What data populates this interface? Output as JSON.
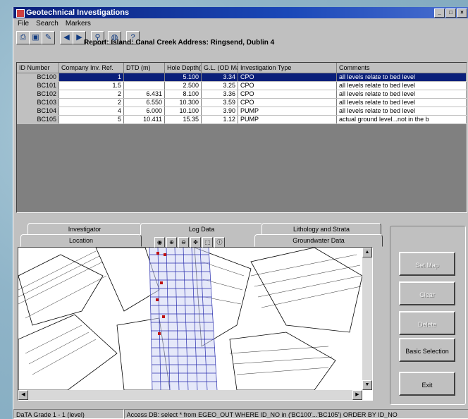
{
  "window": {
    "title": "Geotechnical Investigations"
  },
  "menu": [
    "File",
    "Search",
    "Markers"
  ],
  "report_line": "Report: Island: Canal Creek  Address: Ringsend, Dublin 4",
  "grid": {
    "headers": [
      "ID Number",
      "Company Inv. Ref.",
      "DTD (m)",
      "Hole Depth(m)",
      "G.L. (OD Malin)",
      "Investigation Type",
      "Comments"
    ],
    "rows": [
      [
        "BC100",
        "1",
        "",
        "5.100",
        "3.34",
        "CPO",
        "all levels relate to bed level"
      ],
      [
        "BC101",
        "1.5",
        "",
        "2.500",
        "3.25",
        "CPO",
        "all levels relate to bed level"
      ],
      [
        "BC102",
        "2",
        "6.431",
        "8.100",
        "3.36",
        "CPO",
        "all levels relate to bed level"
      ],
      [
        "BC103",
        "2",
        "6.550",
        "10.300",
        "3.59",
        "CPO",
        "all levels relate to bed level"
      ],
      [
        "BC104",
        "4",
        "6.000",
        "10.100",
        "3.90",
        "PUMP",
        "all levels relate to bed level"
      ],
      [
        "BC105",
        "5",
        "10.411",
        "15.35",
        "1.12",
        "PUMP",
        "actual ground level...not in the b"
      ]
    ]
  },
  "tabs_back": [
    "Investigator",
    "Log Data",
    "Lithology and Strata"
  ],
  "tabs_front": [
    "Location",
    "Groundwater Data"
  ],
  "buttons": {
    "b1": "Set Map",
    "b2": "Clear",
    "b3": "Delete",
    "b4": "Basic Selection",
    "b5": "Exit"
  },
  "status": {
    "left": "DaTA Grade 1 - 1 (level)",
    "right": "Access DB: select * from EGEO_OUT WHERE ID_NO in ('BC100'...'BC105') ORDER BY ID_NO"
  }
}
